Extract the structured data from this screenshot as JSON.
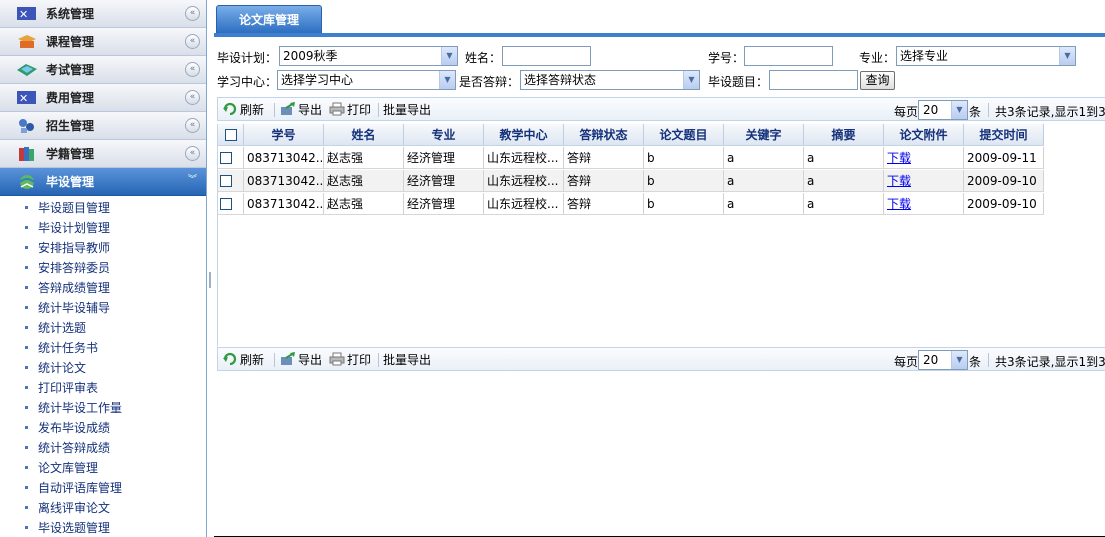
{
  "sidebar": {
    "sections": [
      {
        "label": "系统管理",
        "icon": "system-icon"
      },
      {
        "label": "课程管理",
        "icon": "course-icon"
      },
      {
        "label": "考试管理",
        "icon": "exam-icon"
      },
      {
        "label": "费用管理",
        "icon": "fee-icon"
      },
      {
        "label": "招生管理",
        "icon": "enrollment-icon"
      },
      {
        "label": "学籍管理",
        "icon": "student-status-icon"
      },
      {
        "label": "毕设管理",
        "icon": "graduation-design-icon",
        "active": true
      }
    ],
    "sub_items": [
      "毕设题目管理",
      "毕设计划管理",
      "安排指导教师",
      "安排答辩委员",
      "答辩成绩管理",
      "统计毕设辅导",
      "统计选题",
      "统计任务书",
      "统计论文",
      "打印评审表",
      "统计毕设工作量",
      "发布毕设成绩",
      "统计答辩成绩",
      "论文库管理",
      "自动评语库管理",
      "离线评审论文",
      "毕设选题管理"
    ]
  },
  "tab": {
    "label": "论文库管理"
  },
  "search": {
    "plan_label": "毕设计划：",
    "plan_value": "2009秋季",
    "name_label": "姓名：",
    "name_value": "",
    "student_no_label": "学号：",
    "student_no_value": "",
    "major_label": "专业：",
    "major_value": "选择专业",
    "center_label": "学习中心：",
    "center_value": "选择学习中心",
    "defense_label": "是否答辩：",
    "defense_value": "选择答辩状态",
    "topic_label": "毕设题目：",
    "topic_value": "",
    "query_button": "查询"
  },
  "toolbar": {
    "refresh": "刷新",
    "export": "导出",
    "print": "打印",
    "batch_export": "批量导出",
    "per_page_label": "每页",
    "per_page_value": "20",
    "per_page_unit": "条",
    "records_text": "共3条记录,显示1到3"
  },
  "grid": {
    "columns": [
      "学号",
      "姓名",
      "专业",
      "教学中心",
      "答辩状态",
      "论文题目",
      "关键字",
      "摘要",
      "论文附件",
      "提交时间"
    ],
    "rows": [
      {
        "student_no": "083713042...",
        "name": "赵志强",
        "major": "经济管理",
        "center": "山东远程校...",
        "defense": "答辩",
        "title": "b",
        "keywords": "a",
        "abstract": "a",
        "attachment": "下载",
        "submitted": "2009-09-11"
      },
      {
        "student_no": "083713042...",
        "name": "赵志强",
        "major": "经济管理",
        "center": "山东远程校...",
        "defense": "答辩",
        "title": "b",
        "keywords": "a",
        "abstract": "a",
        "attachment": "下载",
        "submitted": "2009-09-10"
      },
      {
        "student_no": "083713042...",
        "name": "赵志强",
        "major": "经济管理",
        "center": "山东远程校...",
        "defense": "答辩",
        "title": "b",
        "keywords": "a",
        "abstract": "a",
        "attachment": "下载",
        "submitted": "2009-09-10"
      }
    ]
  },
  "colors": {
    "accent": "#3f7fd0",
    "nav_active": "#2665b4",
    "link": "#0000ee"
  }
}
